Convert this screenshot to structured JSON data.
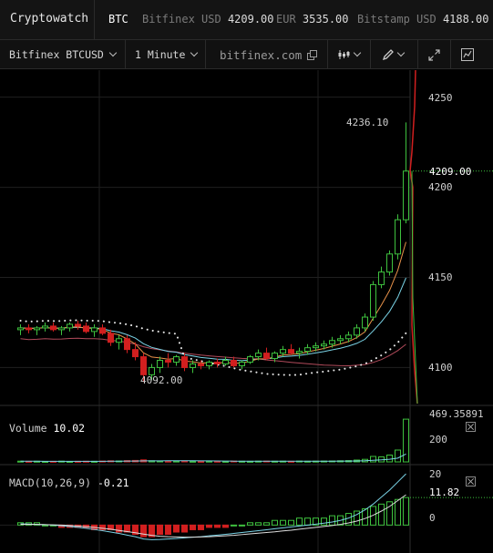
{
  "header": {
    "brand": "Cryptowatch",
    "base": "BTC",
    "tickers": [
      {
        "exchange": "Bitfinex USD",
        "price": "4209.00"
      },
      {
        "exchange": "EUR",
        "price": "3535.00"
      },
      {
        "exchange": "Bitstamp USD",
        "price": "4188.00"
      }
    ]
  },
  "toolbar": {
    "market": "Bitfinex BTCUSD",
    "interval": "1 Minute",
    "domain": "bitfinex.com"
  },
  "price_axis": {
    "ticks": [
      "4250",
      "4200",
      "4150",
      "4100"
    ],
    "current": "4209.00",
    "high_label": "4236.10",
    "low_label": "4092.00"
  },
  "volume_pane": {
    "label": "Volume",
    "value": "10.02",
    "max": "469.35891",
    "tick": "200"
  },
  "macd_pane": {
    "label": "MACD(10,26,9)",
    "value": "-0.21",
    "tick_top": "20",
    "current": "11.82",
    "tick_zero": "0"
  },
  "colors": {
    "up": "#3ec13e",
    "down": "#d11f1f",
    "ema_fast": "#e8924a",
    "ema_slow": "#7ad3e6",
    "ma_long": "#b04a5a",
    "dots": "#e6e6e6"
  },
  "chart_data": {
    "type": "candlestick",
    "interval": "1 Minute",
    "ohlc": [
      [
        4121,
        4124,
        4118,
        4122
      ],
      [
        4122,
        4124,
        4119,
        4121
      ],
      [
        4121,
        4123,
        4118,
        4122
      ],
      [
        4122,
        4125,
        4120,
        4123
      ],
      [
        4123,
        4125,
        4120,
        4121
      ],
      [
        4121,
        4123,
        4118,
        4122
      ],
      [
        4122,
        4125,
        4120,
        4124
      ],
      [
        4124,
        4126,
        4121,
        4123
      ],
      [
        4123,
        4125,
        4119,
        4120
      ],
      [
        4120,
        4124,
        4117,
        4122
      ],
      [
        4122,
        4124,
        4118,
        4119
      ],
      [
        4119,
        4121,
        4112,
        4114
      ],
      [
        4114,
        4118,
        4110,
        4116
      ],
      [
        4116,
        4118,
        4108,
        4110
      ],
      [
        4110,
        4114,
        4104,
        4106
      ],
      [
        4106,
        4108,
        4092,
        4096
      ],
      [
        4096,
        4102,
        4093,
        4100
      ],
      [
        4100,
        4106,
        4097,
        4104
      ],
      [
        4104,
        4108,
        4100,
        4103
      ],
      [
        4103,
        4107,
        4101,
        4106
      ],
      [
        4106,
        4108,
        4098,
        4100
      ],
      [
        4100,
        4104,
        4097,
        4102
      ],
      [
        4102,
        4104,
        4099,
        4101
      ],
      [
        4101,
        4104,
        4099,
        4103
      ],
      [
        4103,
        4105,
        4100,
        4102
      ],
      [
        4102,
        4106,
        4101,
        4104
      ],
      [
        4104,
        4106,
        4100,
        4101
      ],
      [
        4101,
        4104,
        4099,
        4103
      ],
      [
        4103,
        4107,
        4102,
        4106
      ],
      [
        4106,
        4110,
        4104,
        4108
      ],
      [
        4108,
        4111,
        4104,
        4105
      ],
      [
        4105,
        4109,
        4103,
        4108
      ],
      [
        4108,
        4112,
        4106,
        4110
      ],
      [
        4110,
        4113,
        4107,
        4108
      ],
      [
        4108,
        4111,
        4105,
        4109
      ],
      [
        4109,
        4113,
        4107,
        4111
      ],
      [
        4111,
        4114,
        4109,
        4112
      ],
      [
        4112,
        4115,
        4110,
        4113
      ],
      [
        4113,
        4117,
        4111,
        4115
      ],
      [
        4115,
        4118,
        4113,
        4116
      ],
      [
        4116,
        4120,
        4114,
        4118
      ],
      [
        4118,
        4124,
        4116,
        4122
      ],
      [
        4122,
        4130,
        4120,
        4128
      ],
      [
        4128,
        4148,
        4126,
        4146
      ],
      [
        4146,
        4156,
        4144,
        4153
      ],
      [
        4153,
        4165,
        4151,
        4163
      ],
      [
        4163,
        4185,
        4160,
        4182
      ],
      [
        4182,
        4236,
        4180,
        4209
      ]
    ],
    "volume": [
      8,
      6,
      7,
      5,
      6,
      8,
      5,
      6,
      7,
      6,
      9,
      12,
      10,
      14,
      16,
      22,
      12,
      10,
      8,
      9,
      11,
      7,
      6,
      8,
      7,
      6,
      9,
      7,
      6,
      8,
      9,
      7,
      8,
      6,
      9,
      7,
      8,
      9,
      10,
      12,
      14,
      20,
      28,
      60,
      55,
      75,
      130,
      469
    ],
    "macd_hist": [
      1,
      1,
      1,
      0,
      0,
      -1,
      -1,
      -1,
      -1,
      -2,
      -2,
      -2,
      -3,
      -3,
      -4,
      -5,
      -5,
      -4,
      -4,
      -3,
      -3,
      -2,
      -2,
      -1,
      -1,
      -1,
      0,
      0,
      1,
      1,
      1,
      2,
      2,
      2,
      3,
      3,
      3,
      3,
      4,
      4,
      5,
      6,
      7,
      8,
      9,
      10,
      11,
      11.82
    ],
    "macd_line": [
      0.5,
      0.4,
      0.3,
      0.2,
      0.0,
      -0.3,
      -0.6,
      -1.0,
      -1.4,
      -1.9,
      -2.4,
      -3.0,
      -3.6,
      -4.3,
      -5.0,
      -6.0,
      -6.3,
      -6.2,
      -6.0,
      -5.8,
      -5.5,
      -5.2,
      -5.0,
      -4.6,
      -4.3,
      -4.0,
      -3.6,
      -3.2,
      -2.8,
      -2.4,
      -2.0,
      -1.6,
      -1.2,
      -0.8,
      -0.4,
      0.0,
      0.4,
      0.8,
      1.3,
      2.0,
      3.0,
      4.5,
      6.5,
      9.0,
      12.0,
      15.0,
      18.5,
      22.0
    ],
    "macd_signal": [
      0.3,
      0.3,
      0.3,
      0.2,
      0.1,
      0.0,
      -0.2,
      -0.4,
      -0.7,
      -1.0,
      -1.4,
      -1.8,
      -2.3,
      -2.8,
      -3.3,
      -3.9,
      -4.4,
      -4.8,
      -5.0,
      -5.1,
      -5.2,
      -5.2,
      -5.1,
      -5.0,
      -4.8,
      -4.6,
      -4.4,
      -4.1,
      -3.8,
      -3.5,
      -3.2,
      -2.9,
      -2.5,
      -2.2,
      -1.8,
      -1.4,
      -1.0,
      -0.6,
      -0.2,
      0.3,
      0.9,
      1.7,
      2.8,
      4.2,
      6.0,
      8.0,
      10.5,
      13.0
    ],
    "price_ylim": [
      4080,
      4265
    ],
    "volume_ylim": [
      0,
      480
    ],
    "macd_ylim": [
      -12,
      24
    ]
  }
}
